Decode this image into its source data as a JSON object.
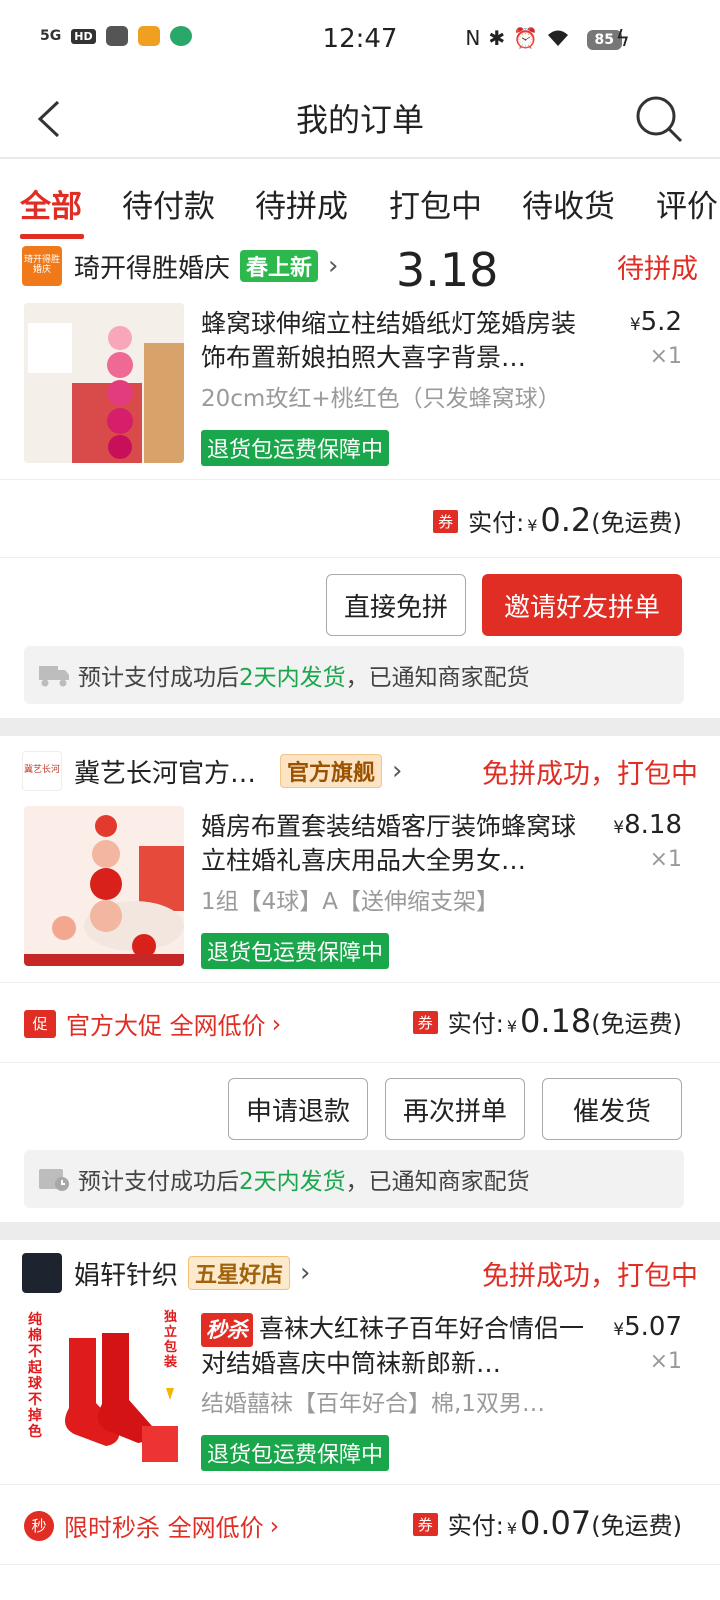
{
  "status_bar": {
    "network": "5G",
    "hd": "HD",
    "time": "12:47",
    "battery": "85",
    "icons": [
      "signal-icon",
      "hd-icon",
      "wechat-icon",
      "weibo-icon",
      "app-icon",
      "nfc-icon",
      "bluetooth-icon",
      "alarm-icon",
      "wifi-icon",
      "battery-icon",
      "charging-icon"
    ]
  },
  "header": {
    "title": "我的订单",
    "back_icon": "back-arrow-icon",
    "search_icon": "search-icon"
  },
  "tabs": [
    {
      "label": "全部",
      "active": true
    },
    {
      "label": "待付款"
    },
    {
      "label": "待拼成"
    },
    {
      "label": "打包中"
    },
    {
      "label": "待收货"
    },
    {
      "label": "评价"
    }
  ],
  "orders": [
    {
      "shop_name": "琦开得胜婚庆",
      "shop_logo_text": "琦开得胜婚庆",
      "shop_badge": "春上新",
      "overlay_number": "3.18",
      "status": "待拼成",
      "goods_title": "蜂窝球伸缩立柱结婚纸灯笼婚房装饰布置新娘拍照大喜字背景…",
      "goods_spec": "20cm玫红+桃红色（只发蜂窝球）",
      "goods_tag": "退货包运费保障中",
      "price_symbol": "¥",
      "price": "5.2",
      "qty": "×1",
      "coupon": "券",
      "pay_label": "实付:",
      "pay_currency": "¥",
      "pay_amount": "0.2",
      "pay_note": "(免运费)",
      "buttons": [
        "直接免拼",
        "邀请好友拼单"
      ],
      "ship_pre": "预计支付成功后",
      "ship_highlight": "2天内发货",
      "ship_post": "，已通知商家配货"
    },
    {
      "shop_name": "冀艺长河官方…",
      "shop_logo_text": "冀艺长河",
      "shop_badge": "官方旗舰",
      "status": "免拼成功，打包中",
      "goods_title": "婚房布置套装结婚客厅装饰蜂窝球立柱婚礼喜庆用品大全男女…",
      "goods_spec": "1组【4球】A【送伸缩支架】",
      "goods_tag": "退货包运费保障中",
      "price_symbol": "¥",
      "price": "8.18",
      "qty": "×1",
      "promo_icon": "促",
      "promo_text": "官方大促 全网低价",
      "coupon": "券",
      "pay_label": "实付:",
      "pay_currency": "¥",
      "pay_amount": "0.18",
      "pay_note": "(免运费)",
      "buttons": [
        "申请退款",
        "再次拼单",
        "催发货"
      ],
      "ship_pre": "预计支付成功后",
      "ship_highlight": "2天内发货",
      "ship_post": "，已通知商家配货"
    },
    {
      "shop_name": "娟轩针织",
      "shop_badge": "五星好店",
      "status": "免拼成功，打包中",
      "seckill_tag": "秒杀",
      "goods_title": "喜袜大红袜子百年好合情侣一对结婚喜庆中筒袜新郎新…",
      "goods_spec": "结婚囍袜【百年好合】棉,1双男…",
      "goods_tag": "退货包运费保障中",
      "price_symbol": "¥",
      "price": "5.07",
      "qty": "×1",
      "img_text_left": "纯棉不起球不掉色",
      "img_text_right": "独立包装",
      "promo_icon": "秒",
      "promo_text": "限时秒杀 全网低价",
      "coupon": "券",
      "pay_label": "实付:",
      "pay_currency": "¥",
      "pay_amount": "0.07",
      "pay_note": "(免运费)"
    }
  ],
  "colors": {
    "accent": "#e02e24",
    "green": "#1aa64b",
    "badge_green": "#2db84d"
  }
}
